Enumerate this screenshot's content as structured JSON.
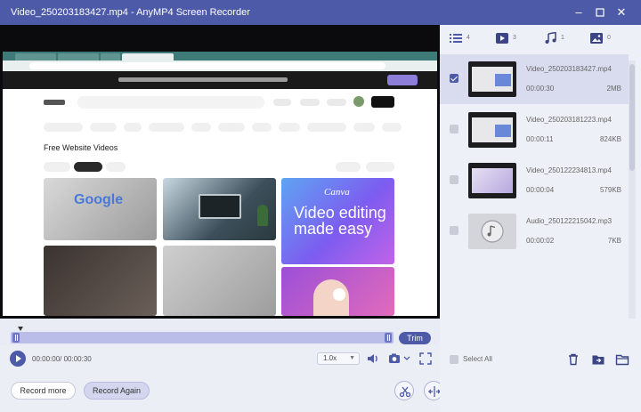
{
  "window": {
    "title": "Video_250203183427.mp4  -  AnyMP4 Screen Recorder",
    "controls": [
      "minimize",
      "maximize",
      "close"
    ]
  },
  "preview": {
    "page_heading": "Free Website Videos",
    "thumbnails": [
      {
        "label": "Google"
      },
      {
        "label": ""
      },
      {
        "label": "Video editing made easy",
        "logo": "Canva"
      },
      {
        "label": ""
      },
      {
        "label": ""
      },
      {
        "label": ""
      }
    ]
  },
  "timeline": {
    "trim_label": "Trim"
  },
  "playback": {
    "time": "00:00:00/ 00:00:30",
    "speed": "1.0x",
    "icons": [
      "play-icon",
      "volume-icon",
      "camera-icon",
      "fullscreen-icon"
    ]
  },
  "bottom": {
    "record_more": "Record more",
    "record_again": "Record Again",
    "tools": [
      "trim-tool-icon",
      "split-tool-icon",
      "convert-tool-icon",
      "merge-tool-icon",
      "compress-tool-icon",
      "metadata-tool-icon",
      "volume-tool-icon",
      "more-tool-icon"
    ]
  },
  "panel": {
    "tabs": [
      {
        "icon": "list-icon",
        "count": "4"
      },
      {
        "icon": "video-icon",
        "count": "3"
      },
      {
        "icon": "music-icon",
        "count": "1"
      },
      {
        "icon": "image-icon",
        "count": "0"
      }
    ],
    "files": [
      {
        "name": "Video_250203183427.mp4",
        "duration": "00:00:30",
        "size": "2MB",
        "selected": true
      },
      {
        "name": "Video_250203181223.mp4",
        "duration": "00:00:11",
        "size": "824KB",
        "selected": false
      },
      {
        "name": "Video_250122234813.mp4",
        "duration": "00:00:04",
        "size": "579KB",
        "selected": false
      },
      {
        "name": "Audio_250122215042.mp3",
        "duration": "00:00:02",
        "size": "7KB",
        "selected": false
      }
    ],
    "select_all": "Select All",
    "actions": [
      "delete-icon",
      "folder-move-icon",
      "open-folder-icon"
    ]
  },
  "colors": {
    "accent": "#4d5aa8",
    "track": "#b9bde7",
    "panel_bg": "#eef0f7"
  }
}
